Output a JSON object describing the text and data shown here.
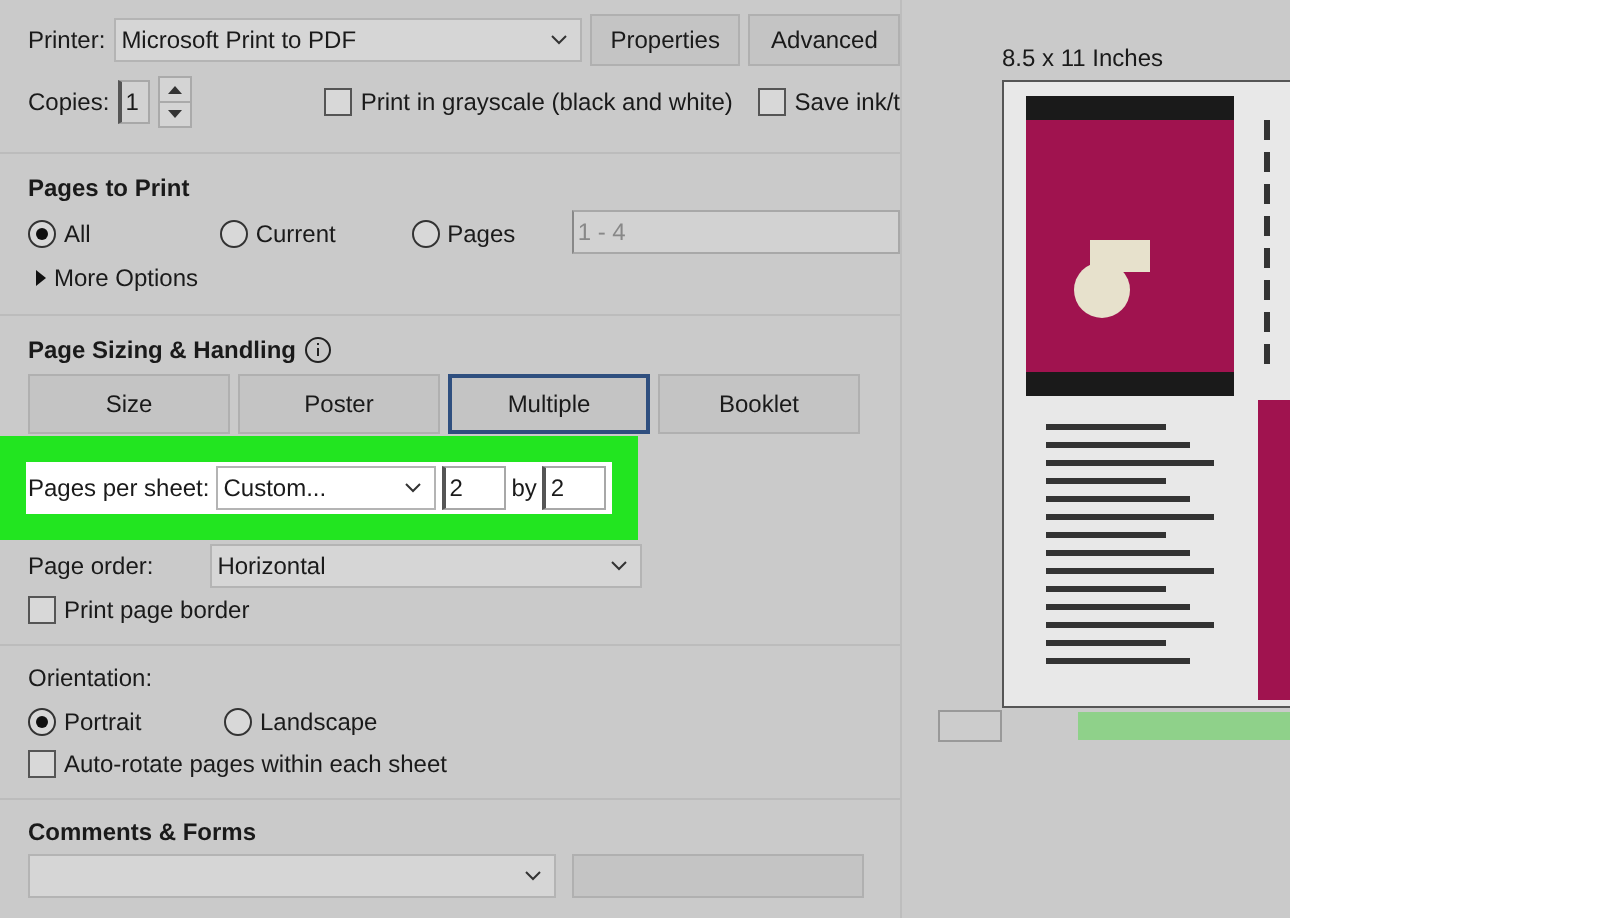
{
  "printer": {
    "label": "Printer:",
    "value": "Microsoft Print to PDF"
  },
  "printer_buttons": [
    "Properties",
    "Advanced"
  ],
  "copies": {
    "label": "Copies:",
    "value": "1"
  },
  "options": [
    {
      "label": "Print in grayscale (black and white)",
      "checked": false
    },
    {
      "label": "Save ink/t",
      "checked": false
    }
  ],
  "pages_to_print": {
    "title": "Pages to Print",
    "radios": [
      {
        "label": "All",
        "selected": true
      },
      {
        "label": "Current",
        "selected": false
      },
      {
        "label": "Pages",
        "selected": false
      }
    ],
    "range": "1 - 4",
    "more_options": "More Options"
  },
  "page_sizing": {
    "title": "Page Sizing & Handling",
    "tabs": [
      {
        "label": "Size",
        "selected": false
      },
      {
        "label": "Poster",
        "selected": false
      },
      {
        "label": "Multiple",
        "selected": true
      },
      {
        "label": "Booklet",
        "selected": false
      }
    ],
    "pages_per_sheet": {
      "label": "Pages per sheet:",
      "value": "Custom...",
      "columns": "2",
      "by": "by",
      "rows": "2"
    },
    "page_order": {
      "label": "Page order:",
      "value": "Horizontal"
    },
    "print_border": {
      "label": "Print page border",
      "checked": false
    }
  },
  "orientation": {
    "title": "Orientation:",
    "radios": [
      {
        "label": "Portrait",
        "selected": true
      },
      {
        "label": "Landscape",
        "selected": false
      }
    ],
    "auto_rotate": {
      "label": "Auto-rotate pages within each sheet",
      "checked": false
    }
  },
  "comments_forms": {
    "title": "Comments & Forms"
  },
  "preview": {
    "size": "8.5 x 11 Inches"
  }
}
